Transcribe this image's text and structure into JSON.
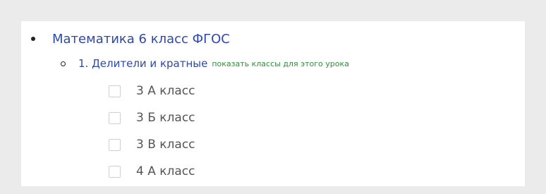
{
  "course": {
    "title": "Математика 6 класс ФГОС"
  },
  "lesson": {
    "title": "1. Делители и кратные",
    "show_classes_link": "показать классы для этого урока"
  },
  "classes": [
    {
      "label": "3 А класс",
      "checked": false
    },
    {
      "label": "3 Б класс",
      "checked": false
    },
    {
      "label": "3 В класс",
      "checked": false
    },
    {
      "label": "4 А класс",
      "checked": false
    }
  ],
  "colors": {
    "link": "#2e49a5",
    "secondary_link": "#2f8f3a",
    "label_text": "#555555",
    "background": "#ebebeb",
    "panel": "#ffffff"
  }
}
